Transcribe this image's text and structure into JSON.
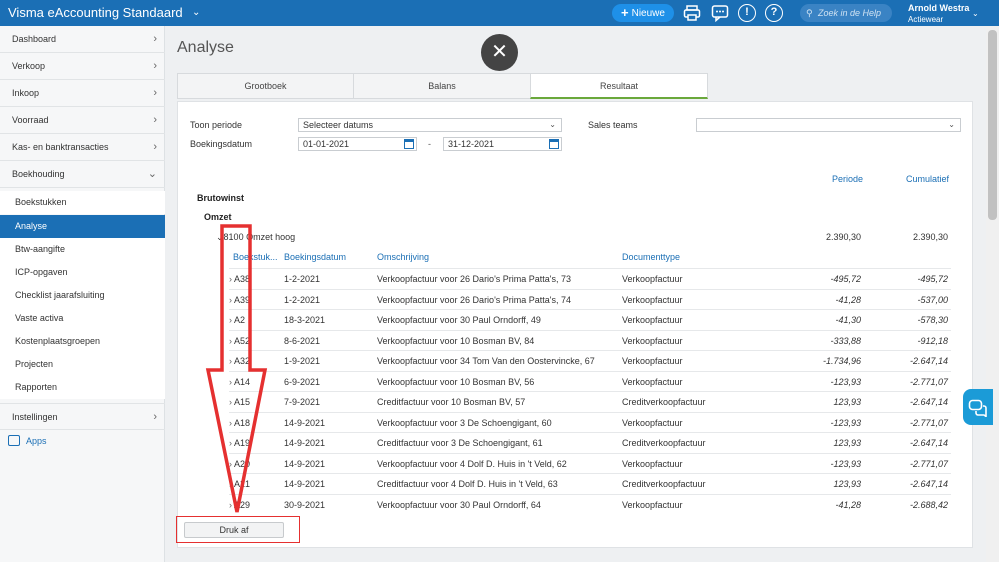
{
  "topbar": {
    "brand": "Visma eAccounting Standaard",
    "new_button": "Nieuwe",
    "help_search_placeholder": "Zoek in de Help",
    "user_name": "Arnold Westra",
    "user_company": "Actiewear"
  },
  "sidebar": {
    "items": [
      {
        "label": "Dashboard"
      },
      {
        "label": "Verkoop"
      },
      {
        "label": "Inkoop"
      },
      {
        "label": "Voorraad"
      },
      {
        "label": "Kas- en banktransacties"
      },
      {
        "label": "Boekhouding"
      }
    ],
    "subitems": [
      {
        "label": "Boekstukken"
      },
      {
        "label": "Analyse"
      },
      {
        "label": "Btw-aangifte"
      },
      {
        "label": "ICP-opgaven"
      },
      {
        "label": "Checklist jaarafsluiting"
      },
      {
        "label": "Vaste activa"
      },
      {
        "label": "Kostenplaatsgroepen"
      },
      {
        "label": "Projecten"
      },
      {
        "label": "Rapporten"
      }
    ],
    "instellingen": "Instellingen",
    "apps": "Apps"
  },
  "page": {
    "title": "Analyse",
    "close_glyph": "✕"
  },
  "tabs": [
    {
      "label": "Grootboek"
    },
    {
      "label": "Balans"
    },
    {
      "label": "Resultaat"
    }
  ],
  "filters": {
    "period_label": "Toon periode",
    "period_value": "Selecteer datums",
    "date_label": "Boekingsdatum",
    "date_from": "01-01-2021",
    "date_to": "31-12-2021",
    "date_sep": "-",
    "sales_teams_label": "Sales teams",
    "sales_teams_value": ""
  },
  "report": {
    "col_periode": "Periode",
    "col_cumulatief": "Cumulatief",
    "brutowinst": "Brutowinst",
    "omzet": "Omzet",
    "account_label": "8100 Omzet hoog",
    "account_periode": "2.390,30",
    "account_cumulatief": "2.390,30",
    "sub_headers": {
      "boekstuk": "Boekstuk...",
      "datum": "Boekingsdatum",
      "omschrijving": "Omschrijving",
      "documenttype": "Documenttype"
    },
    "rows": [
      {
        "nr": "A38",
        "datum": "1-2-2021",
        "omschrijving": "Verkoopfactuur voor 26 Dario's Prima Patta's, 73",
        "type": "Verkoopfactuur",
        "periode": "-495,72",
        "cumulatief": "-495,72"
      },
      {
        "nr": "A39",
        "datum": "1-2-2021",
        "omschrijving": "Verkoopfactuur voor 26 Dario's Prima Patta's, 74",
        "type": "Verkoopfactuur",
        "periode": "-41,28",
        "cumulatief": "-537,00"
      },
      {
        "nr": "A2",
        "datum": "18-3-2021",
        "omschrijving": "Verkoopfactuur voor 30 Paul Orndorff, 49",
        "type": "Verkoopfactuur",
        "periode": "-41,30",
        "cumulatief": "-578,30"
      },
      {
        "nr": "A52",
        "datum": "8-6-2021",
        "omschrijving": "Verkoopfactuur voor 10 Bosman BV, 84",
        "type": "Verkoopfactuur",
        "periode": "-333,88",
        "cumulatief": "-912,18"
      },
      {
        "nr": "A32",
        "datum": "1-9-2021",
        "omschrijving": "Verkoopfactuur voor 34 Tom Van den Oostervincke, 67",
        "type": "Verkoopfactuur",
        "periode": "-1.734,96",
        "cumulatief": "-2.647,14"
      },
      {
        "nr": "A14",
        "datum": "6-9-2021",
        "omschrijving": "Verkoopfactuur voor 10 Bosman BV, 56",
        "type": "Verkoopfactuur",
        "periode": "-123,93",
        "cumulatief": "-2.771,07"
      },
      {
        "nr": "A15",
        "datum": "7-9-2021",
        "omschrijving": "Creditfactuur voor 10 Bosman BV, 57",
        "type": "Creditverkoopfactuur",
        "periode": "123,93",
        "cumulatief": "-2.647,14"
      },
      {
        "nr": "A18",
        "datum": "14-9-2021",
        "omschrijving": "Verkoopfactuur voor 3 De Schoengigant, 60",
        "type": "Verkoopfactuur",
        "periode": "-123,93",
        "cumulatief": "-2.771,07"
      },
      {
        "nr": "A19",
        "datum": "14-9-2021",
        "omschrijving": "Creditfactuur voor 3 De Schoengigant, 61",
        "type": "Creditverkoopfactuur",
        "periode": "123,93",
        "cumulatief": "-2.647,14"
      },
      {
        "nr": "A20",
        "datum": "14-9-2021",
        "omschrijving": "Verkoopfactuur voor 4 Dolf D. Huis in 't Veld, 62",
        "type": "Verkoopfactuur",
        "periode": "-123,93",
        "cumulatief": "-2.771,07"
      },
      {
        "nr": "A21",
        "datum": "14-9-2021",
        "omschrijving": "Creditfactuur voor 4 Dolf D. Huis in 't Veld, 63",
        "type": "Creditverkoopfactuur",
        "periode": "123,93",
        "cumulatief": "-2.647,14"
      },
      {
        "nr": "A29",
        "datum": "30-9-2021",
        "omschrijving": "Verkoopfactuur voor 30 Paul Orndorff, 64",
        "type": "Verkoopfactuur",
        "periode": "-41,28",
        "cumulatief": "-2.688,42"
      }
    ]
  },
  "print_button": "Druk af",
  "colors": {
    "brand_blue": "#1b6fb5",
    "accent_green": "#6aa83b",
    "annotation_red": "#e53030"
  }
}
